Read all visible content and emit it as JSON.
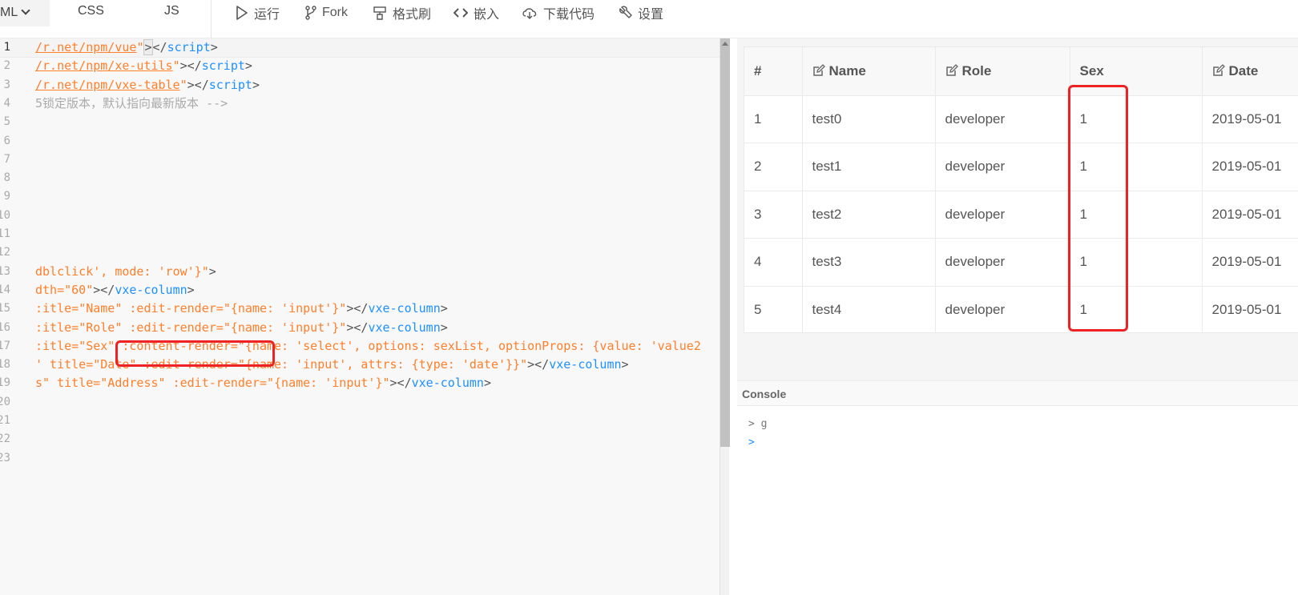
{
  "toolbar": {
    "lang_html": "ML",
    "tabs": [
      "CSS",
      "JS"
    ],
    "buttons": {
      "run": "运行",
      "fork": "Fork",
      "format": "格式刷",
      "embed": "嵌入",
      "download": "下载代码",
      "settings": "设置"
    }
  },
  "editor": {
    "line_numbers": [
      "1",
      "2",
      "3",
      "4",
      "5",
      "6",
      "7",
      "8",
      "9",
      "10",
      "11",
      "12",
      "13",
      "14",
      "15",
      "16",
      "17",
      "18",
      "19",
      "20",
      "21",
      "22",
      "23"
    ],
    "lines": {
      "l1_url": "/r.net/npm/vue",
      "l1_q": "\"",
      "l1_b": ">",
      "l1_rest": "</",
      "l1_tag": "script",
      "l1_end": ">",
      "l2_url": "/r.net/npm/xe-utils",
      "l2_q": "\"",
      "l2_rest": "></",
      "l2_tag": "script",
      "l2_end": ">",
      "l3_url": "/r.net/npm/vxe-table",
      "l3_q": "\"",
      "l3_rest": "></",
      "l3_tag": "script",
      "l3_end": ">",
      "l4_cmt": "5锁定版本，默认指向最新版本 -->",
      "l13_str": "dblclick', mode: 'row'}\"",
      "l13_end": ">",
      "l14_a": "dth=",
      "l14_str": "\"60\"",
      "l14_b": "></",
      "l14_tag": "vxe-column",
      "l14_end": ">",
      "l15_a": ":itle=",
      "l15_s1": "\"Name\"",
      "l15_b": " :edit-render=",
      "l15_s2": "\"{name: 'input'}\"",
      "l15_c": "></",
      "l15_tag": "vxe-column",
      "l15_end": ">",
      "l16_a": ":itle=",
      "l16_s1": "\"Role\"",
      "l16_b": " :edit-render=",
      "l16_s2": "\"{name: 'input'}\"",
      "l16_c": "></",
      "l16_tag": "vxe-column",
      "l16_end": ">",
      "l17_a": ":itle=",
      "l17_s1": "\"Sex\"",
      "l17_b": " :content-render=",
      "l17_s2": "\"{name: 'select', options: sexList, optionProps: {value: 'value2",
      "l18_a": "' title=",
      "l18_s1": "\"Date\"",
      "l18_b": " :edit-render=",
      "l18_s2": "\"{name: 'input', attrs: {type: 'date'}}\"",
      "l18_c": "></",
      "l18_tag": "vxe-column",
      "l18_end": ">",
      "l19_a": "s\" title=",
      "l19_s1": "\"Address\"",
      "l19_b": " :edit-render=",
      "l19_s2": "\"{name: 'input'}\"",
      "l19_c": "></",
      "l19_tag": "vxe-column",
      "l19_end": ">"
    }
  },
  "grid": {
    "headers": {
      "seq": "#",
      "name": "Name",
      "role": "Role",
      "sex": "Sex",
      "date": "Date"
    },
    "rows": [
      {
        "seq": "1",
        "name": "test0",
        "role": "developer",
        "sex": "1",
        "date": "2019-05-01"
      },
      {
        "seq": "2",
        "name": "test1",
        "role": "developer",
        "sex": "1",
        "date": "2019-05-01"
      },
      {
        "seq": "3",
        "name": "test2",
        "role": "developer",
        "sex": "1",
        "date": "2019-05-01"
      },
      {
        "seq": "4",
        "name": "test3",
        "role": "developer",
        "sex": "1",
        "date": "2019-05-01"
      },
      {
        "seq": "5",
        "name": "test4",
        "role": "developer",
        "sex": "1",
        "date": "2019-05-01"
      }
    ]
  },
  "console": {
    "title": "Console",
    "lines": [
      "> g",
      ">"
    ]
  },
  "colors": {
    "highlight": "#ee2222",
    "string": "#ff7f2a",
    "tag": "#1e90ff"
  }
}
